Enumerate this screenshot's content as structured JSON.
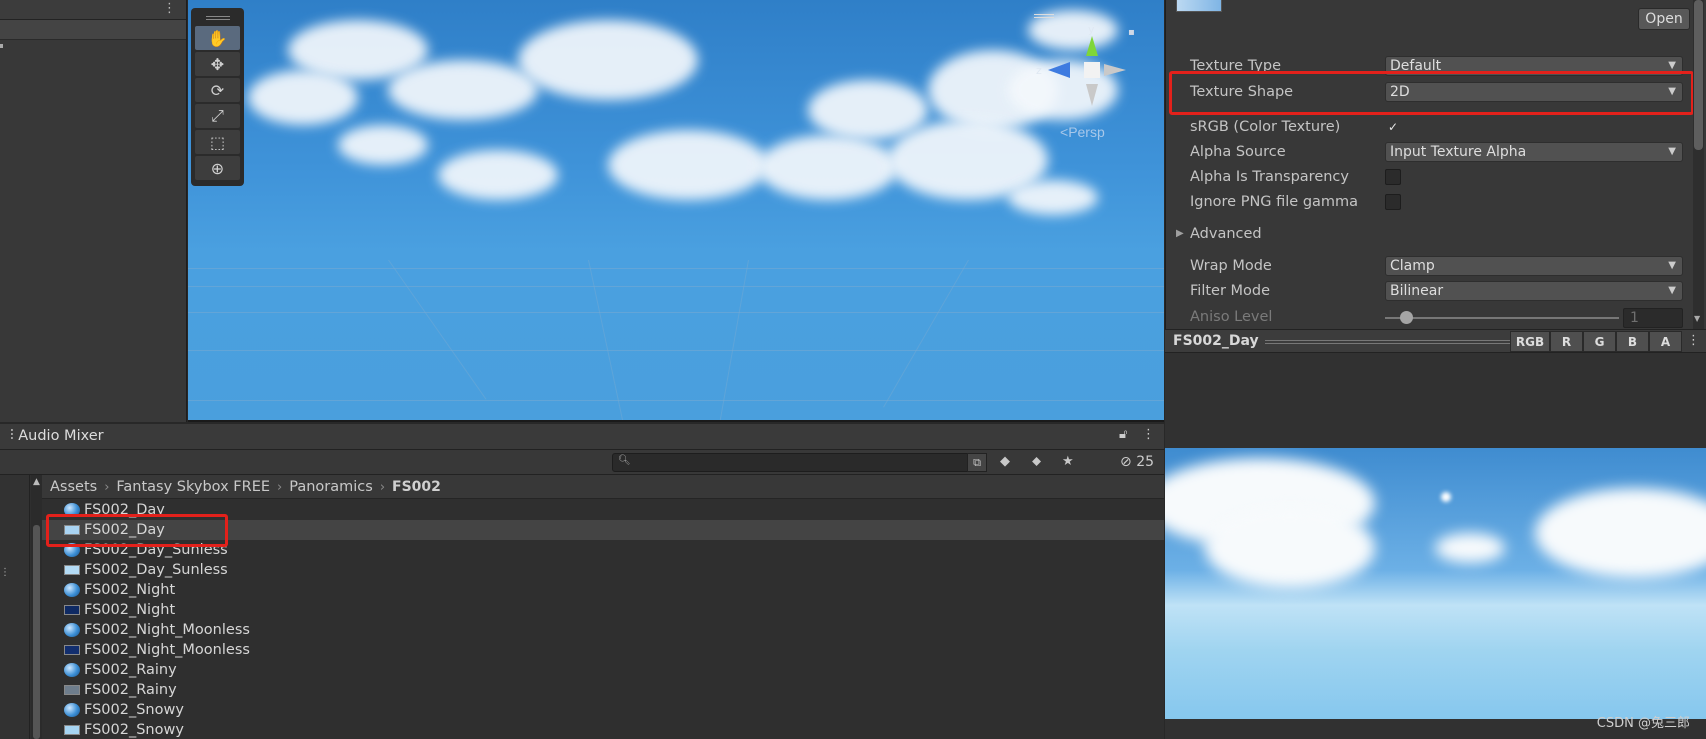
{
  "scene": {
    "tools": [
      {
        "icon": "hand-icon",
        "glyph": "✋"
      },
      {
        "icon": "move-icon",
        "glyph": "✥"
      },
      {
        "icon": "rotate-icon",
        "glyph": "⟳"
      },
      {
        "icon": "scale-icon",
        "glyph": "⤢"
      },
      {
        "icon": "rect-icon",
        "glyph": "⬚"
      },
      {
        "icon": "transform-icon",
        "glyph": "⊕"
      }
    ],
    "gizmo_y": "y",
    "gizmo_z": "z",
    "persp_label": "Persp"
  },
  "inspector": {
    "open_label": "Open",
    "texture_type_label": "Texture Type",
    "texture_type_value": "Default",
    "texture_shape_label": "Texture Shape",
    "texture_shape_value": "2D",
    "srgb_label": "sRGB (Color Texture)",
    "srgb_checked": "✓",
    "alpha_source_label": "Alpha Source",
    "alpha_source_value": "Input Texture Alpha",
    "alpha_transparency_label": "Alpha Is Transparency",
    "ignore_png_label": "Ignore PNG file gamma",
    "advanced_label": "Advanced",
    "wrap_mode_label": "Wrap Mode",
    "wrap_mode_value": "Clamp",
    "filter_mode_label": "Filter Mode",
    "filter_mode_value": "Bilinear",
    "aniso_label": "Aniso Level",
    "aniso_value": "1"
  },
  "preview": {
    "title": "FS002_Day",
    "channels": [
      "RGB",
      "R",
      "G",
      "B",
      "A"
    ],
    "watermark": "CSDN @兔三郎"
  },
  "project": {
    "tab_label": "Audio Mixer",
    "hidden_count": "25",
    "breadcrumb": [
      "Assets",
      "Fantasy Skybox FREE",
      "Panoramics",
      "FS002"
    ],
    "files": [
      {
        "name": "FS002_Day",
        "kind": "sphere",
        "tex_color": ""
      },
      {
        "name": "FS002_Day",
        "kind": "tex",
        "tex_color": "#a9d3f2"
      },
      {
        "name": "FS002_Day_Sunless",
        "kind": "sphere",
        "tex_color": ""
      },
      {
        "name": "FS002_Day_Sunless",
        "kind": "tex",
        "tex_color": "#b3dbf5"
      },
      {
        "name": "FS002_Night",
        "kind": "sphere",
        "tex_color": ""
      },
      {
        "name": "FS002_Night",
        "kind": "tex",
        "tex_color": "#0f2a63"
      },
      {
        "name": "FS002_Night_Moonless",
        "kind": "sphere",
        "tex_color": ""
      },
      {
        "name": "FS002_Night_Moonless",
        "kind": "tex",
        "tex_color": "#122e6e"
      },
      {
        "name": "FS002_Rainy",
        "kind": "sphere",
        "tex_color": ""
      },
      {
        "name": "FS002_Rainy",
        "kind": "tex",
        "tex_color": "#6e7d8c"
      },
      {
        "name": "FS002_Snowy",
        "kind": "sphere",
        "tex_color": ""
      },
      {
        "name": "FS002_Snowy",
        "kind": "tex",
        "tex_color": "#a6d4f2"
      }
    ],
    "selected_index": 1
  },
  "colors": {
    "highlight_red": "#e3211b",
    "sky_blue": "#3f93d9"
  }
}
